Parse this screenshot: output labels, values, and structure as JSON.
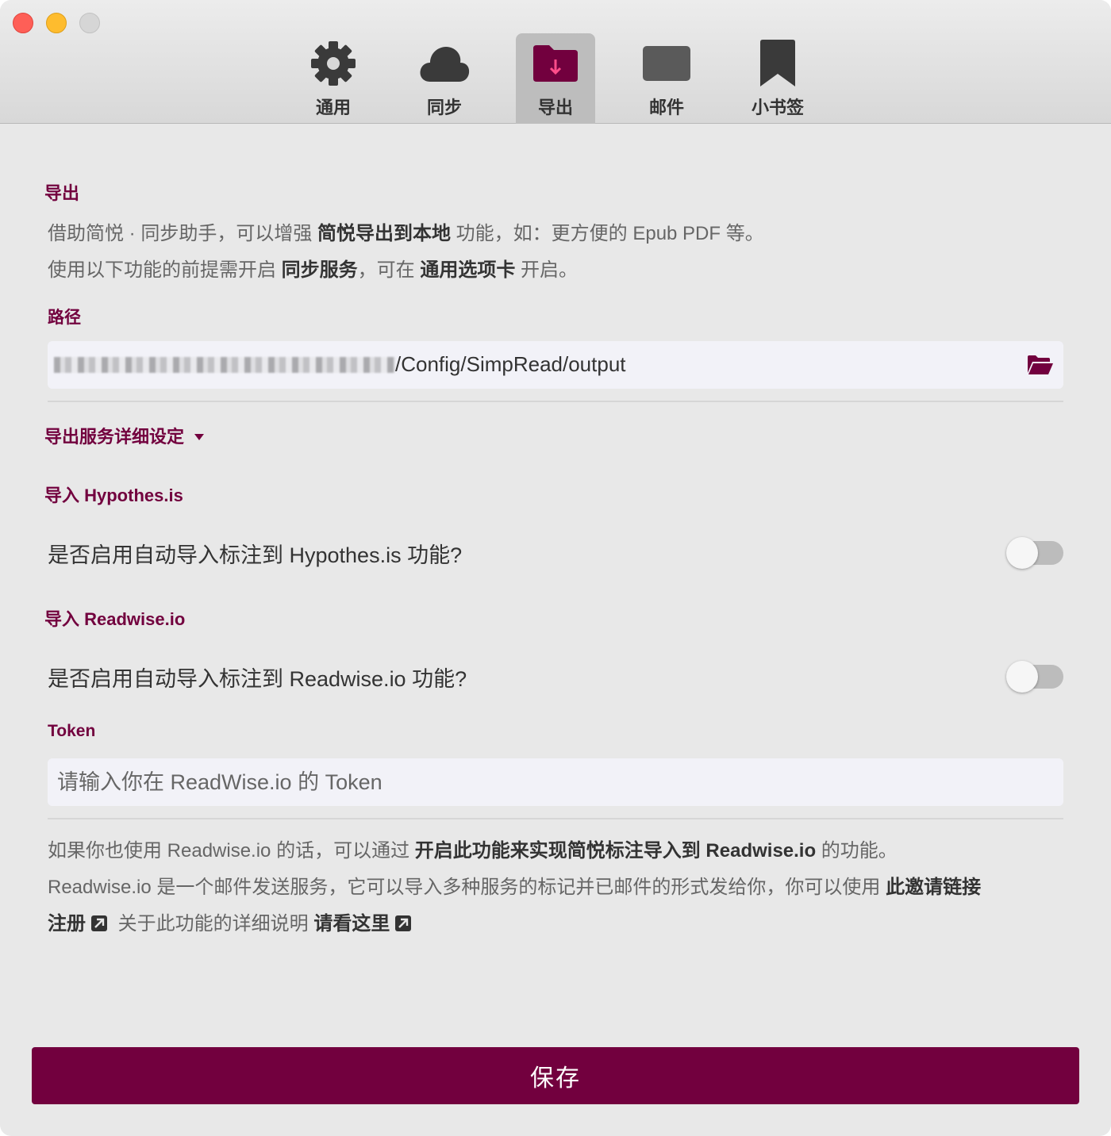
{
  "tabs": [
    {
      "label": "通用",
      "icon": "gear-icon"
    },
    {
      "label": "同步",
      "icon": "cloud-icon"
    },
    {
      "label": "导出",
      "icon": "folder-download-icon"
    },
    {
      "label": "邮件",
      "icon": "mail-icon"
    },
    {
      "label": "小书签",
      "icon": "bookmark-icon"
    }
  ],
  "active_tab": "导出",
  "export": {
    "title": "导出",
    "desc1_a": "借助简悦 · 同步助手，可以增强 ",
    "desc1_b": "简悦导出到本地",
    "desc1_c": " 功能，如：更方便的 Epub PDF 等。",
    "desc2_a": "使用以下功能的前提需开启 ",
    "desc2_b": "同步服务",
    "desc2_c": "，可在 ",
    "desc2_d": "通用选项卡",
    "desc2_e": " 开启。",
    "path_label": "路径",
    "path_value": "/Config/SimpRead/output",
    "details_label": "导出服务详细设定"
  },
  "hypothesis": {
    "title": "导入 Hypothes.is",
    "toggle_text": "是否启用自动导入标注到 Hypothes.is 功能?",
    "enabled": false
  },
  "readwise": {
    "title": "导入 Readwise.io",
    "toggle_text": "是否启用自动导入标注到 Readwise.io 功能?",
    "enabled": false,
    "token_label": "Token",
    "token_placeholder": "请输入你在 ReadWise.io 的 Token",
    "info1_a": "如果你也使用 Readwise.io 的话，可以通过 ",
    "info1_b": "开启此功能来实现简悦标注导入到 Readwise.io",
    "info1_c": " 的功能。",
    "info2_a": "Readwise.io 是一个邮件发送服务，它可以导入多种服务的标记并已邮件的形式发给你，你可以使用 ",
    "info2_b": "此邀请链接",
    "info3_a": "注册",
    "info3_b": " 关于此功能的详细说明 ",
    "info3_c": "请看这里"
  },
  "save_label": "保存",
  "colors": {
    "accent": "#72003e",
    "tab_active": "#bdbdbd",
    "background": "#e8e8e8"
  }
}
